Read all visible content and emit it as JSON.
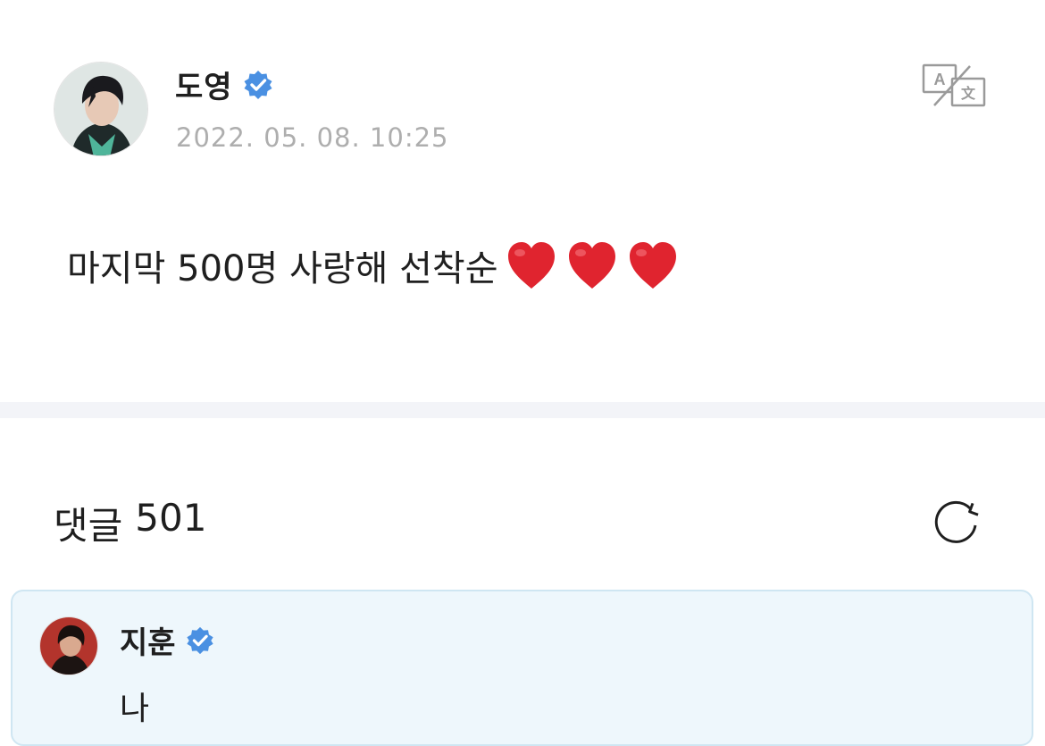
{
  "post": {
    "author": "도영",
    "verified_icon": "verified-badge-icon",
    "timestamp": "2022. 05. 08. 10:25",
    "translate_icon": "translate-icon",
    "text": "마지막 500명 사랑해 선착순",
    "emoji": [
      "heart",
      "heart",
      "heart"
    ]
  },
  "comments": {
    "label": "댓글",
    "count": "501",
    "refresh_icon": "refresh-icon",
    "items": [
      {
        "author": "지훈",
        "verified": true,
        "text": "나"
      }
    ]
  },
  "colors": {
    "verified": "#4a90e2",
    "timestamp": "#aeaeae",
    "heart": "#e0242f",
    "comment_bg": "#eef7fc",
    "comment_border": "#cfe6f2",
    "divider": "#f3f4f8"
  }
}
